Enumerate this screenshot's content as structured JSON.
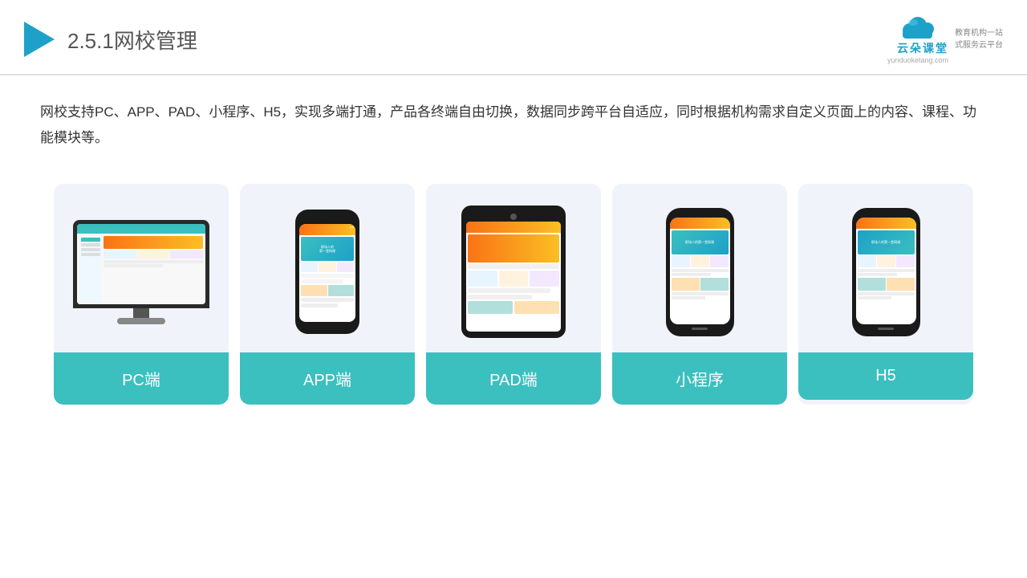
{
  "header": {
    "title_number": "2.5.1",
    "title_text": "网校管理",
    "logo_name": "云朵课堂",
    "logo_url": "yunduoketang.com",
    "logo_slogan": "教育机构一站\n式服务云平台"
  },
  "description": "网校支持PC、APP、PAD、小程序、H5，实现多端打通，产品各终端自由切换，数据同步跨平台自适应，同时根据机构需求自定义页面上的内容、课程、功能模块等。",
  "cards": [
    {
      "id": "pc",
      "label": "PC端"
    },
    {
      "id": "app",
      "label": "APP端"
    },
    {
      "id": "pad",
      "label": "PAD端"
    },
    {
      "id": "miniprogram",
      "label": "小程序"
    },
    {
      "id": "h5",
      "label": "H5"
    }
  ],
  "colors": {
    "accent": "#3bbfbf",
    "header_line": "#e0e0e0",
    "card_bg": "#f0f4fa",
    "card_label_bg": "#3bbfbf",
    "device_body": "#1a1a1a",
    "orange": "#f97316"
  }
}
